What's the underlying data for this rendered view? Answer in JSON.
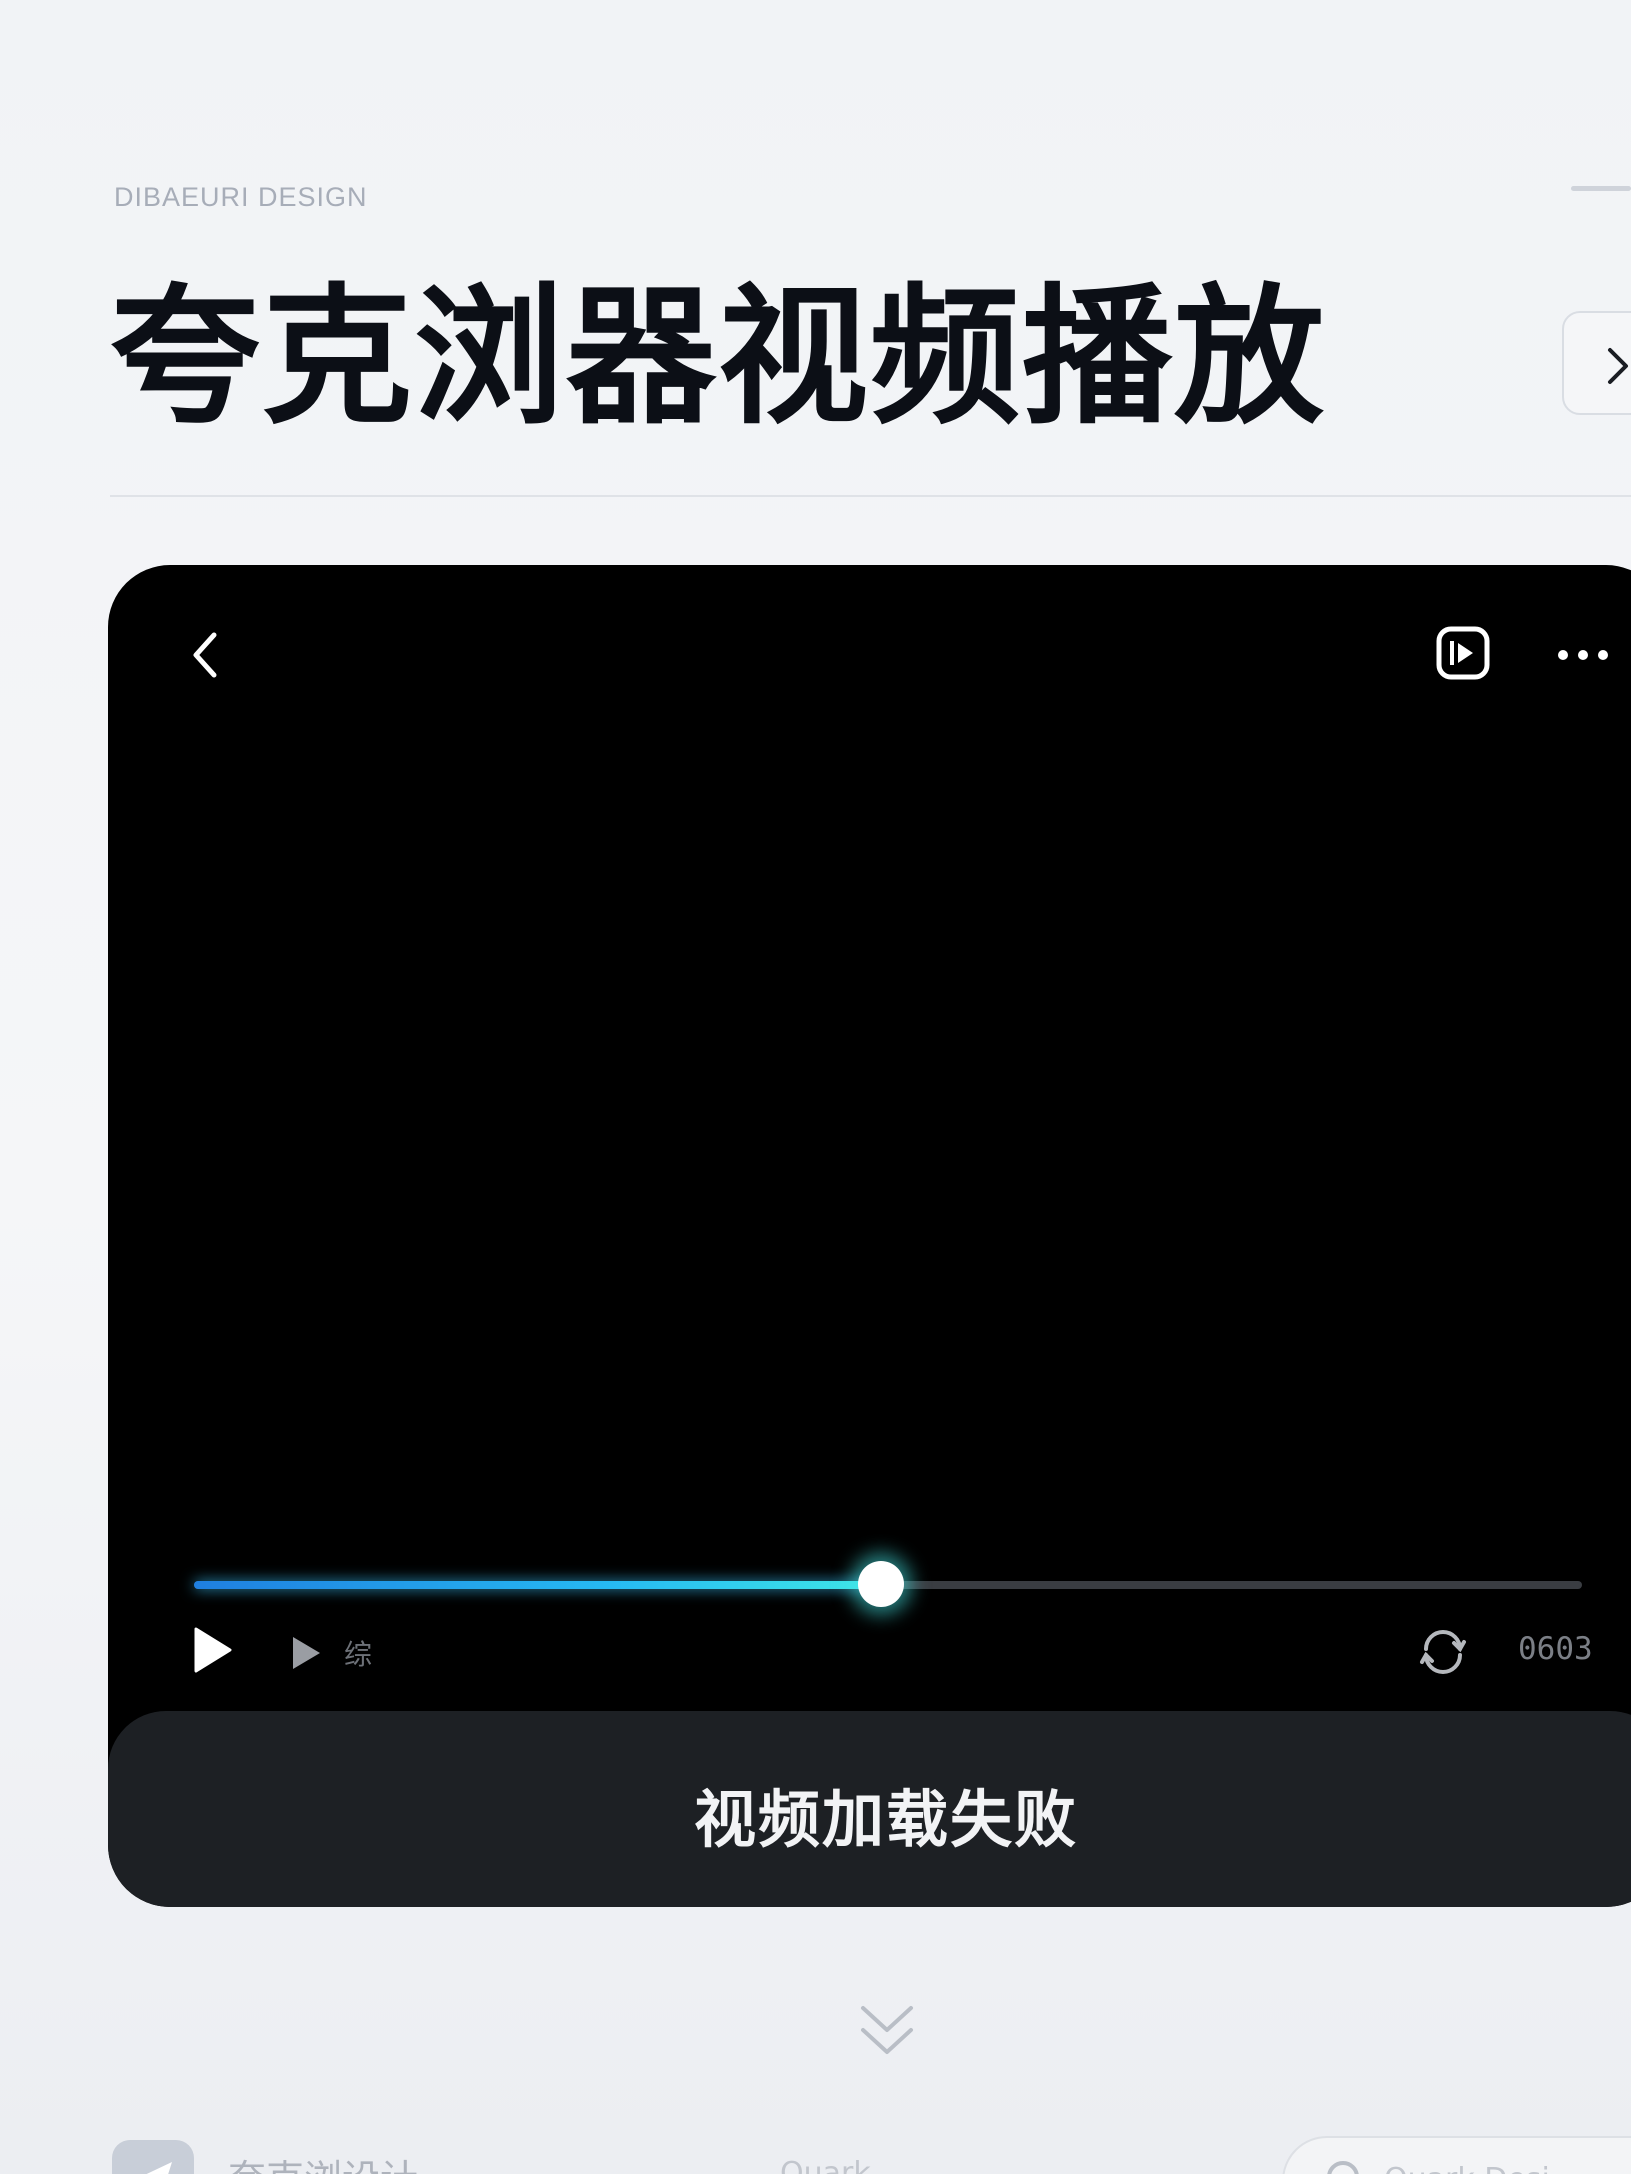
{
  "header": {
    "brand": "DIBAEURI DESIGN",
    "title": "夸克浏器视频播放",
    "next_icon": "chevron-right-icon"
  },
  "player": {
    "back_icon": "chevron-left-icon",
    "cast_icon": "cast-icon",
    "more_icon": "more-horizontal-icon",
    "progress": 0.495,
    "accent": "#26b9f2",
    "controls": {
      "play_icon": "play-icon",
      "next_frame_icon": "play-small-icon",
      "speed_label": "综",
      "loop_icon": "loop-icon",
      "time_label": "0603"
    },
    "error_message": "视频加载失败",
    "banner_color": "#1d2024"
  },
  "scroll_icon": "double-chevron-down-icon",
  "footer": {
    "logo_icon": "send-icon",
    "brand": "夸克浏设计",
    "center_text": "Quark ...",
    "search_placeholder": "Quark Desi..."
  }
}
